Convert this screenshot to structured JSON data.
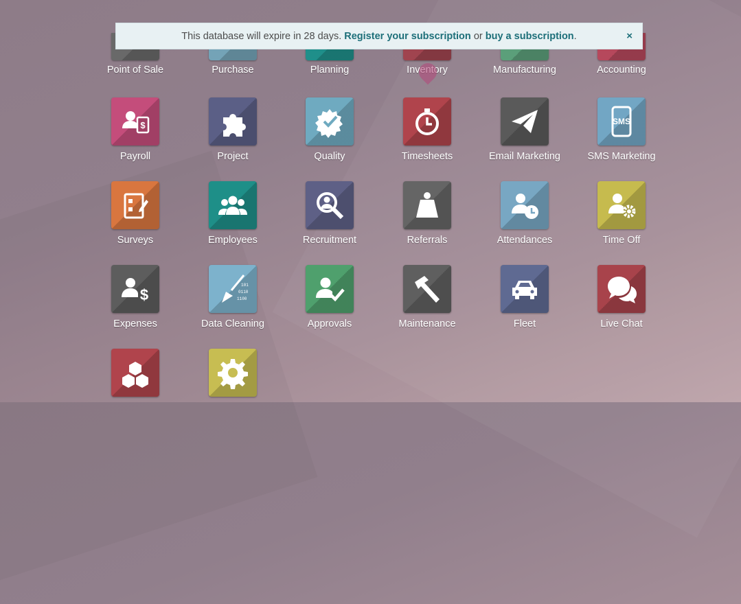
{
  "banner": {
    "text_before": "This database will expire in 28 days.",
    "link1": "Register your subscription",
    "text_middle": "or",
    "link2": "buy a subscription",
    "text_after": ".",
    "close": "×"
  },
  "apps": [
    {
      "label": "Point of Sale",
      "color": "#696969",
      "icon": "pos-icon"
    },
    {
      "label": "Purchase",
      "color": "#74a3b7",
      "icon": "purchase-icon"
    },
    {
      "label": "Planning",
      "color": "#1f8f8a",
      "icon": "planning-icon"
    },
    {
      "label": "Inventory",
      "color": "#a0444f",
      "icon": "inventory-icon"
    },
    {
      "label": "Manufacturing",
      "color": "#5b9f7a",
      "icon": "manufacturing-icon"
    },
    {
      "label": "Accounting",
      "color": "#b6485c",
      "icon": "accounting-icon"
    },
    {
      "label": "Payroll",
      "color": "#c44d7b",
      "icon": "payroll-icon"
    },
    {
      "label": "Project",
      "color": "#5b5f86",
      "icon": "puzzle-icon"
    },
    {
      "label": "Quality",
      "color": "#6faac0",
      "icon": "quality-icon"
    },
    {
      "label": "Timesheets",
      "color": "#b0444c",
      "icon": "stopwatch-icon"
    },
    {
      "label": "Email Marketing",
      "color": "#5a5a5a",
      "icon": "paper-plane-icon"
    },
    {
      "label": "SMS Marketing",
      "color": "#72a6c4",
      "icon": "sms-phone-icon"
    },
    {
      "label": "Surveys",
      "color": "#d9763f",
      "icon": "survey-icon"
    },
    {
      "label": "Employees",
      "color": "#1e8f88",
      "icon": "employees-icon"
    },
    {
      "label": "Recruitment",
      "color": "#5e6086",
      "icon": "magnifier-person-icon"
    },
    {
      "label": "Referrals",
      "color": "#656565",
      "icon": "superhero-icon"
    },
    {
      "label": "Attendances",
      "color": "#78a7c3",
      "icon": "attendance-icon"
    },
    {
      "label": "Time Off",
      "color": "#c6bb4e",
      "icon": "time-off-icon"
    },
    {
      "label": "Expenses",
      "color": "#5d5d5d",
      "icon": "expenses-icon"
    },
    {
      "label": "Data Cleaning",
      "color": "#7db2cc",
      "icon": "broom-icon"
    },
    {
      "label": "Approvals",
      "color": "#4fa06d",
      "icon": "approval-icon"
    },
    {
      "label": "Maintenance",
      "color": "#5f5f5f",
      "icon": "hammer-icon"
    },
    {
      "label": "Fleet",
      "color": "#5f6a92",
      "icon": "car-icon"
    },
    {
      "label": "Live Chat",
      "color": "#a8434b",
      "icon": "chat-icon"
    },
    {
      "label": "",
      "color": "#b0444c",
      "icon": "cubes-icon"
    },
    {
      "label": "",
      "color": "#c7bd52",
      "icon": "gear-icon"
    }
  ]
}
